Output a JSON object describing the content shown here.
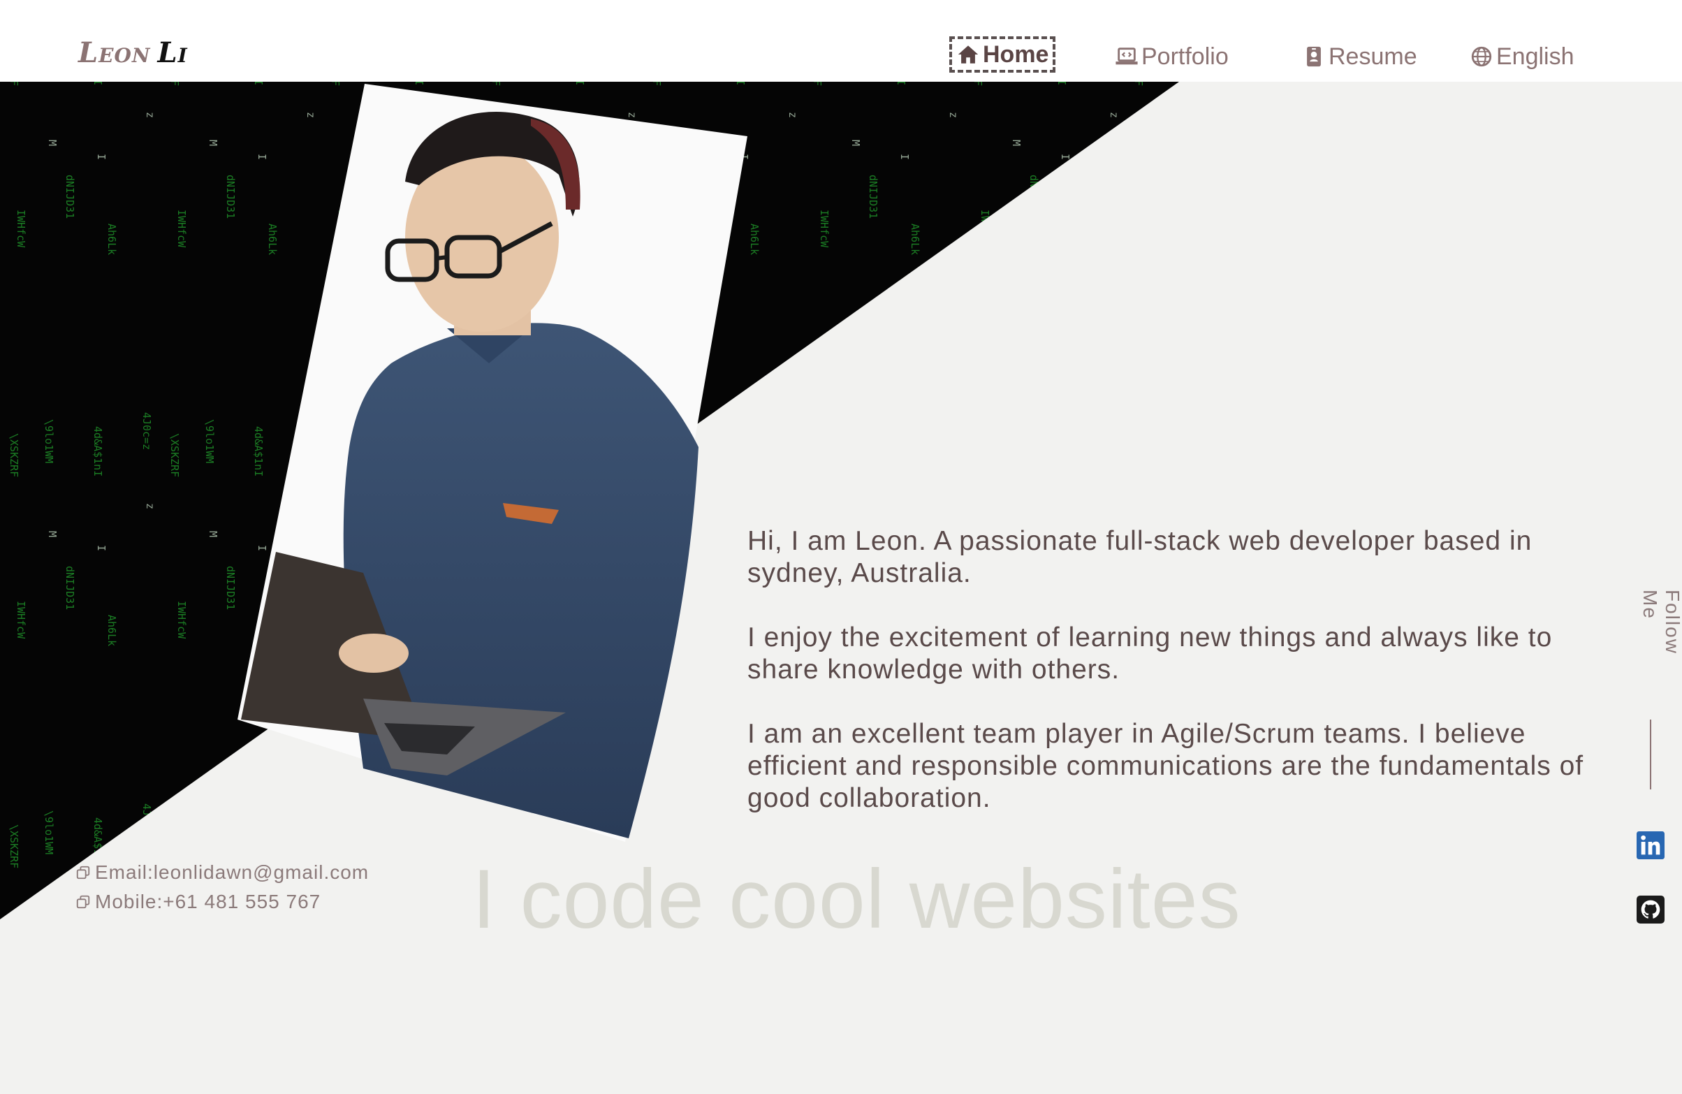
{
  "logo": {
    "first": "Leon",
    "last": "Li"
  },
  "nav": {
    "home": "Home",
    "portfolio": "Portfolio",
    "resume": "Resume",
    "language": "English"
  },
  "hero": {
    "paragraphs": [
      "Hi, I am Leon. A passionate full-stack web developer based in sydney, Australia.",
      "I enjoy the excitement of learning new things and always like to share knowledge with others.",
      "I am an excellent team player in Agile/Scrum teams. I believe efficient and responsible communications are the fundamentals of good collaboration."
    ],
    "tagline": "I code cool websites"
  },
  "contact": {
    "email": "Email:leonlidawn@gmail.com",
    "mobile": "Mobile:+61 481 555 767"
  },
  "follow": {
    "label": "Follow Me"
  },
  "colors": {
    "accent": "#8b7373",
    "text_dark": "#5a4a4a",
    "background": "#f2f2f0",
    "matrix_bg": "#050505",
    "matrix_green": "#1f9a2a",
    "linkedin": "#2867b2"
  },
  "icons": {
    "home": "home-icon",
    "portfolio": "laptop-code-icon",
    "resume": "id-badge-icon",
    "language": "globe-icon",
    "email": "copy-icon",
    "mobile": "copy-icon",
    "linkedin": "linkedin-icon",
    "github": "github-icon"
  }
}
